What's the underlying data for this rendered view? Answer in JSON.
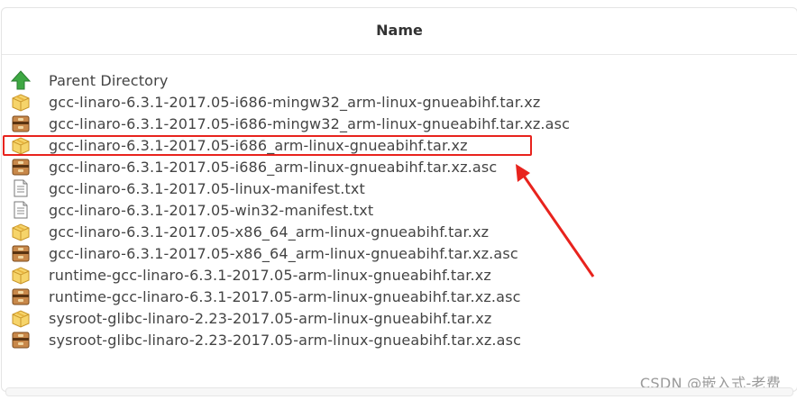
{
  "header": {
    "name_label": "Name"
  },
  "files": [
    {
      "name": "Parent Directory",
      "icon": "up-arrow-icon"
    },
    {
      "name": "gcc-linaro-6.3.1-2017.05-i686-mingw32_arm-linux-gnueabihf.tar.xz",
      "icon": "package-icon"
    },
    {
      "name": "gcc-linaro-6.3.1-2017.05-i686-mingw32_arm-linux-gnueabihf.tar.xz.asc",
      "icon": "archive-icon"
    },
    {
      "name": "gcc-linaro-6.3.1-2017.05-i686_arm-linux-gnueabihf.tar.xz",
      "icon": "package-icon"
    },
    {
      "name": "gcc-linaro-6.3.1-2017.05-i686_arm-linux-gnueabihf.tar.xz.asc",
      "icon": "archive-icon"
    },
    {
      "name": "gcc-linaro-6.3.1-2017.05-linux-manifest.txt",
      "icon": "text-file-icon"
    },
    {
      "name": "gcc-linaro-6.3.1-2017.05-win32-manifest.txt",
      "icon": "text-file-icon"
    },
    {
      "name": "gcc-linaro-6.3.1-2017.05-x86_64_arm-linux-gnueabihf.tar.xz",
      "icon": "package-icon"
    },
    {
      "name": "gcc-linaro-6.3.1-2017.05-x86_64_arm-linux-gnueabihf.tar.xz.asc",
      "icon": "archive-icon"
    },
    {
      "name": "runtime-gcc-linaro-6.3.1-2017.05-arm-linux-gnueabihf.tar.xz",
      "icon": "package-icon"
    },
    {
      "name": "runtime-gcc-linaro-6.3.1-2017.05-arm-linux-gnueabihf.tar.xz.asc",
      "icon": "archive-icon"
    },
    {
      "name": "sysroot-glibc-linaro-2.23-2017.05-arm-linux-gnueabihf.tar.xz",
      "icon": "package-icon"
    },
    {
      "name": "sysroot-glibc-linaro-2.23-2017.05-arm-linux-gnueabihf.tar.xz.asc",
      "icon": "archive-icon"
    }
  ],
  "highlight": {
    "color": "#e8231d"
  },
  "watermark": "CSDN @嵌入式-老费",
  "colors": {
    "highlight": "#e8231d",
    "package": "#f2c94c",
    "archive": "#b5793a",
    "up_arrow": "#3ea843"
  }
}
